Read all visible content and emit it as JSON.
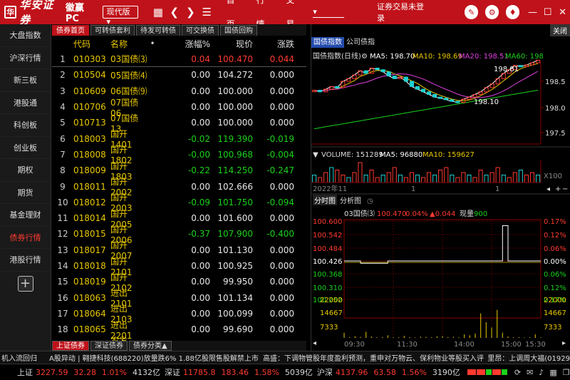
{
  "titlebar": {
    "logo_mark": "华",
    "logo_text": "华安证券",
    "app_name": "徽赢PC",
    "edition": "现代版",
    "menu": [
      "首页",
      "行情",
      "交易"
    ],
    "login_status": "证券交易未登录"
  },
  "sidebar": {
    "items": [
      "大盘指数",
      "沪深行情",
      "新三板",
      "港股通",
      "科创板",
      "创业板",
      "期权",
      "期货",
      "基金理财",
      "债券行情",
      "港股行情"
    ],
    "active_index": 9
  },
  "bond": {
    "tabs": [
      "债券首页",
      "可转债套利",
      "待发可转债",
      "可交换债",
      "国债回购"
    ],
    "headers": {
      "code": "代码",
      "name": "名称",
      "dot": "•",
      "chg": "涨幅%",
      "price": "现价",
      "diff": "涨跌"
    },
    "rows": [
      {
        "idx": "1",
        "code": "010303",
        "name": "03国债⑶",
        "chg": "0.04",
        "price": "100.470",
        "diff": "0.044",
        "dir": "up"
      },
      {
        "idx": "2",
        "code": "010504",
        "name": "05国债⑷",
        "chg": "0.00",
        "price": "104.272",
        "diff": "0.000",
        "dir": "fl"
      },
      {
        "idx": "3",
        "code": "010609",
        "name": "06国债⑼",
        "chg": "0.00",
        "price": "100.000",
        "diff": "0.000",
        "dir": "fl"
      },
      {
        "idx": "4",
        "code": "010706",
        "name": "07国债06",
        "chg": "0.00",
        "price": "100.000",
        "diff": "0.000",
        "dir": "fl"
      },
      {
        "idx": "5",
        "code": "010713",
        "name": "07国债13",
        "chg": "0.00",
        "price": "100.000",
        "diff": "0.000",
        "dir": "fl"
      },
      {
        "idx": "6",
        "code": "018003",
        "name": "国开1401",
        "chg": "-0.02",
        "price": "119.390",
        "diff": "-0.019",
        "dir": "dn"
      },
      {
        "idx": "7",
        "code": "018008",
        "name": "国开1802",
        "chg": "-0.00",
        "price": "100.968",
        "diff": "-0.004",
        "dir": "dn"
      },
      {
        "idx": "8",
        "code": "018009",
        "name": "国开1803",
        "chg": "-0.22",
        "price": "114.250",
        "diff": "-0.247",
        "dir": "dn"
      },
      {
        "idx": "9",
        "code": "018011",
        "name": "国开2002",
        "chg": "0.00",
        "price": "102.666",
        "diff": "0.000",
        "dir": "fl"
      },
      {
        "idx": "10",
        "code": "018012",
        "name": "国开2003",
        "chg": "-0.09",
        "price": "101.750",
        "diff": "-0.094",
        "dir": "dn"
      },
      {
        "idx": "11",
        "code": "018014",
        "name": "国开2005",
        "chg": "0.00",
        "price": "101.600",
        "diff": "0.000",
        "dir": "fl"
      },
      {
        "idx": "12",
        "code": "018015",
        "name": "国开2006",
        "chg": "-0.37",
        "price": "107.900",
        "diff": "-0.400",
        "dir": "dn"
      },
      {
        "idx": "13",
        "code": "018017",
        "name": "国开2007",
        "chg": "0.00",
        "price": "101.130",
        "diff": "0.000",
        "dir": "fl"
      },
      {
        "idx": "14",
        "code": "018018",
        "name": "国开2101",
        "chg": "0.00",
        "price": "100.925",
        "diff": "0.000",
        "dir": "fl"
      },
      {
        "idx": "15",
        "code": "018019",
        "name": "国开2102",
        "chg": "0.00",
        "price": "99.950",
        "diff": "0.000",
        "dir": "fl"
      },
      {
        "idx": "16",
        "code": "018063",
        "name": "进出2101",
        "chg": "0.00",
        "price": "101.134",
        "diff": "0.000",
        "dir": "fl"
      },
      {
        "idx": "17",
        "code": "018064",
        "name": "进出2103",
        "chg": "0.00",
        "price": "100.099",
        "diff": "0.000",
        "dir": "fl"
      },
      {
        "idx": "18",
        "code": "018065",
        "name": "进出2201",
        "chg": "0.00",
        "price": "99.690",
        "diff": "0.000",
        "dir": "fl"
      },
      {
        "idx": "19",
        "code": "018083",
        "name": "农发2001",
        "chg": "0.00",
        "price": "101.000",
        "diff": "0.000",
        "dir": "fl"
      }
    ],
    "bottom_tabs": [
      "上证债券",
      "深证债券",
      "债券分类▲"
    ]
  },
  "right": {
    "close_label": "关闭",
    "tabs": [
      "国债指数",
      "公司债指"
    ],
    "kline": {
      "label": "国债指数(日线)",
      "ma5": "MA5: 198.70",
      "ma10": "MA10: 198.69",
      "ma20": "MA20: 198.51",
      "ma60": "MA60: 198",
      "high_label": "198.81",
      "low_label": "198.10",
      "y_ticks": [
        "198.5",
        "198.0",
        "197.5"
      ]
    },
    "volume": {
      "label": "VOLUME: 151289",
      "ma5": "MA5: 96880",
      "ma10": "MA10: 159627",
      "unit": "X100",
      "x_labels": [
        "2022年11",
        "1",
        "1"
      ]
    },
    "intraday": {
      "tabs": [
        "分时图",
        "分析图"
      ],
      "title": "03国债⑶",
      "price": "100.470",
      "pct": "0.04%",
      "chg": "▲0.044",
      "vol_label": "现量",
      "vol": "900",
      "left_ticks": [
        "100.600",
        "100.542",
        "100.484",
        "100.426",
        "100.368",
        "100.310",
        "100.252"
      ],
      "right_ticks": [
        "0.17%",
        "0.12%",
        "0.06%",
        "0.00%",
        "0.06%",
        "0.12%",
        "0.17%"
      ],
      "vol_ticks": [
        "22000",
        "14667",
        "7333"
      ],
      "time_labels": [
        "09:30",
        "11:30",
        "14:00",
        "15:00",
        "15:30"
      ],
      "price_series": [
        0.0,
        0.0,
        0.0,
        -0.01,
        -0.01,
        -0.01,
        -0.01,
        -0.01,
        0.0,
        0.0,
        0.0,
        0.0,
        0.0,
        0.0,
        0.0,
        0.0,
        0.0,
        0.0,
        0.0,
        0.0,
        0.0,
        0.0,
        0.0,
        0.0,
        0.0,
        0.0,
        0.0,
        0.0,
        0.0,
        0.15,
        0.0,
        0.0,
        0.0,
        0.0,
        0.0,
        0.0,
        0.0
      ],
      "vol_series": [
        3000,
        500,
        1000,
        600,
        3500,
        800,
        400,
        500,
        1500,
        300,
        400,
        1200,
        500,
        300,
        700,
        600,
        400,
        900,
        1000,
        500,
        600,
        400,
        2000,
        1500,
        2500,
        14000,
        9000,
        6000,
        16000,
        3000,
        800,
        400,
        500,
        300,
        400,
        2000,
        300
      ]
    }
  },
  "news": {
    "items": [
      "机入流回归",
      "A股异动 | 翱捷科技(688220)放量跌6% 1.88亿股限售股解禁上市",
      "高盛：下调物管股年度盈利预测，重申对万物云、保利物业等股买入评",
      "里昂：上调周大福(01929"
    ]
  },
  "ticker": {
    "sh_label": "上证",
    "sh_val": "3227.59",
    "sh_chg": "32.28",
    "sh_pct": "1.01%",
    "sh_amt": "4132亿",
    "sz_label": "深证",
    "sz_val": "11785.8",
    "sz_chg": "183.46",
    "sz_pct": "1.58%",
    "sz_amt": "5039亿",
    "hs_label": "沪深",
    "hs_val": "4137.96",
    "hs_chg": "63.58",
    "hs_pct": "1.56%",
    "hs_amt": "3190亿"
  },
  "colors": {
    "brand": "#c0121a",
    "up": "#ff3a30",
    "down": "#1bd21b",
    "code": "#e8c800"
  }
}
